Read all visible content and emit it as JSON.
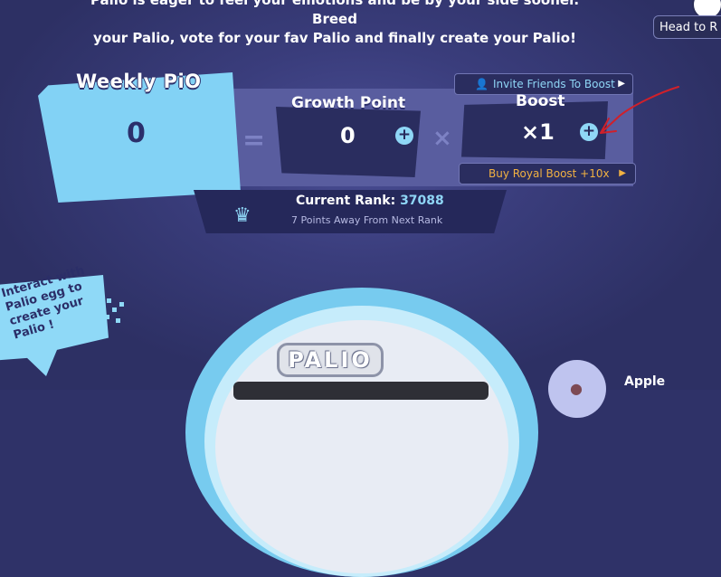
{
  "intro": {
    "line1": "Palio is eager to feel your emotions and be by your side sooner. Breed",
    "line2": "your Palio, vote for your fav Palio and finally create your Palio!"
  },
  "header": {
    "head_to_label": "Head to R"
  },
  "weekly": {
    "title": "Weekly PiO",
    "value": "0"
  },
  "equation": {
    "equals": "=",
    "times": "×"
  },
  "growth": {
    "title": "Growth Point",
    "value": "0",
    "plus": "+"
  },
  "boost": {
    "invite_label": "Invite Friends To Boost",
    "title": "Boost",
    "value": "×1",
    "plus": "+",
    "royal_label": "Buy Royal Boost +10x"
  },
  "rank": {
    "label": "Current Rank:",
    "value": "37088",
    "sub": "7 Points Away From Next Rank"
  },
  "speech": {
    "text": "Interact with Palio egg to create your Palio !"
  },
  "egg": {
    "logo": "PALIO"
  },
  "player": {
    "name": "Apple"
  },
  "icons": {
    "invite": "person-icon",
    "arrow": "triangle-right-icon",
    "rank": "crown-icon",
    "apple": "apple-icon"
  },
  "colors": {
    "background": "#2f3268",
    "accent_blue": "#8fd6f6",
    "gold": "#f1b142",
    "annotation_red": "#d0202a"
  }
}
